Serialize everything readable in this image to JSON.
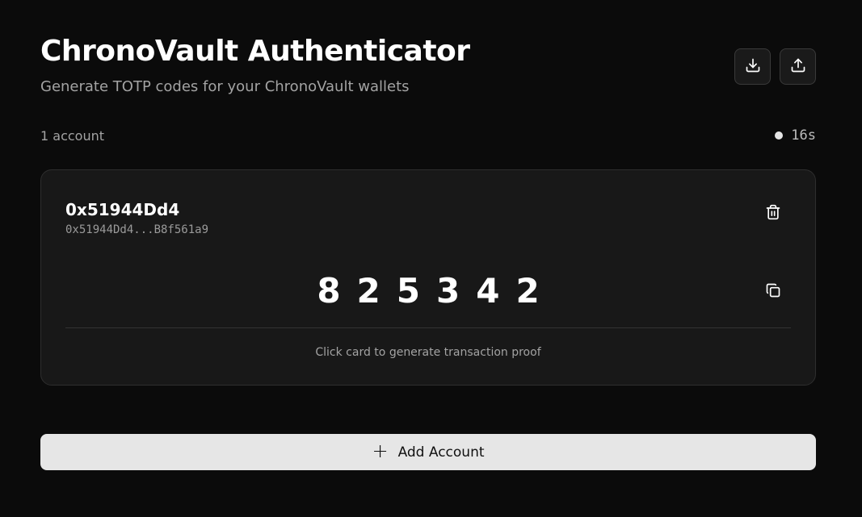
{
  "header": {
    "title": "ChronoVault Authenticator",
    "subtitle": "Generate TOTP codes for your ChronoVault wallets",
    "actions": [
      {
        "name": "download",
        "icon": "download-icon"
      },
      {
        "name": "upload",
        "icon": "upload-icon"
      }
    ]
  },
  "status": {
    "account_count": "1 account",
    "countdown": "16s"
  },
  "accounts": [
    {
      "name": "0x51944Dd4",
      "address": "0x51944Dd4...B8f561a9",
      "code": "825342",
      "hint": "Click card to generate transaction proof",
      "delete_icon": "trash-icon",
      "copy_icon": "copy-icon"
    }
  ],
  "add_button": {
    "icon": "+",
    "label": "Add Account"
  },
  "colors": {
    "background": "#0b0b0b",
    "card": "#181818",
    "button": "#e6e6e6",
    "muted_text": "#a3a3a3"
  }
}
